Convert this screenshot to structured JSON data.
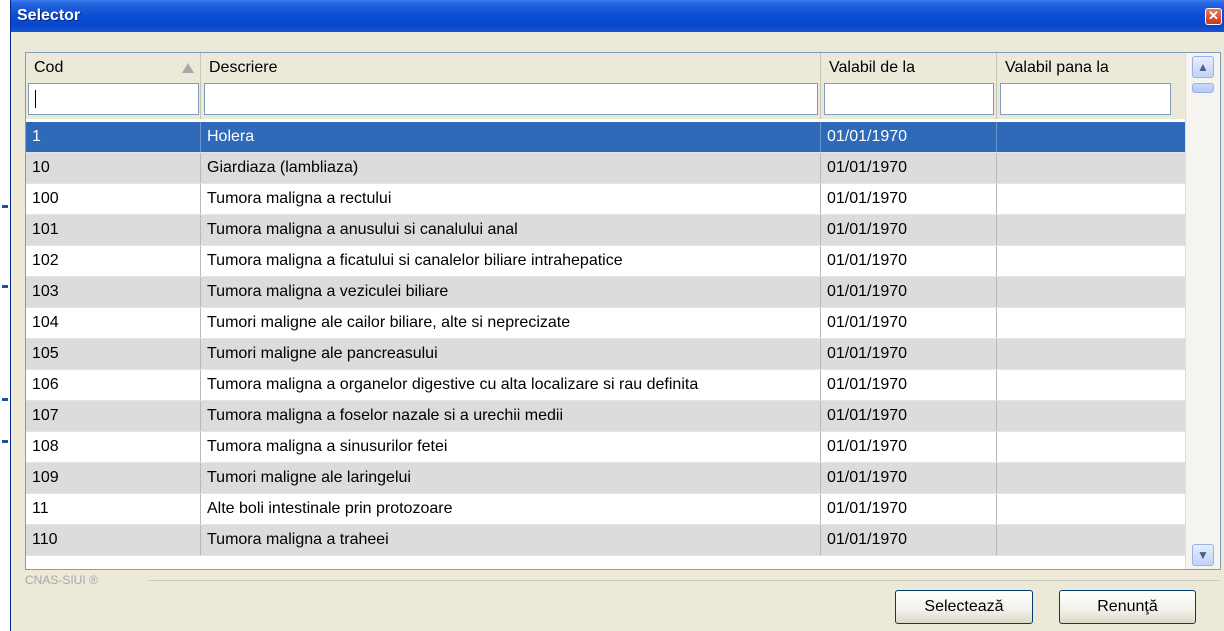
{
  "window": {
    "title": "Selector"
  },
  "grid": {
    "columns": [
      {
        "label": "Cod"
      },
      {
        "label": "Descriere"
      },
      {
        "label": "Valabil de la"
      },
      {
        "label": "Valabil pana la"
      }
    ],
    "filters": {
      "cod": "",
      "descriere": "",
      "valabil_de_la": "",
      "valabil_pana_la": ""
    },
    "rows": [
      {
        "cod": "1",
        "descriere": "Holera",
        "valabil_de_la": "01/01/1970",
        "valabil_pana_la": ""
      },
      {
        "cod": "10",
        "descriere": "Giardiaza (lambliaza)",
        "valabil_de_la": "01/01/1970",
        "valabil_pana_la": ""
      },
      {
        "cod": "100",
        "descriere": "Tumora maligna a rectului",
        "valabil_de_la": "01/01/1970",
        "valabil_pana_la": ""
      },
      {
        "cod": "101",
        "descriere": "Tumora maligna a anusului si canalului anal",
        "valabil_de_la": "01/01/1970",
        "valabil_pana_la": ""
      },
      {
        "cod": "102",
        "descriere": "Tumora maligna a ficatului si canalelor biliare intrahepatice",
        "valabil_de_la": "01/01/1970",
        "valabil_pana_la": ""
      },
      {
        "cod": "103",
        "descriere": "Tumora maligna a veziculei biliare",
        "valabil_de_la": "01/01/1970",
        "valabil_pana_la": ""
      },
      {
        "cod": "104",
        "descriere": "Tumori maligne ale cailor biliare, alte si neprecizate",
        "valabil_de_la": "01/01/1970",
        "valabil_pana_la": ""
      },
      {
        "cod": "105",
        "descriere": "Tumori maligne ale pancreasului",
        "valabil_de_la": "01/01/1970",
        "valabil_pana_la": ""
      },
      {
        "cod": "106",
        "descriere": "Tumora maligna a organelor digestive cu alta localizare si rau definita",
        "valabil_de_la": "01/01/1970",
        "valabil_pana_la": ""
      },
      {
        "cod": "107",
        "descriere": "Tumora maligna a foselor nazale si a urechii medii",
        "valabil_de_la": "01/01/1970",
        "valabil_pana_la": ""
      },
      {
        "cod": "108",
        "descriere": "Tumora maligna a sinusurilor fetei",
        "valabil_de_la": "01/01/1970",
        "valabil_pana_la": ""
      },
      {
        "cod": "109",
        "descriere": "Tumori maligne ale laringelui",
        "valabil_de_la": "01/01/1970",
        "valabil_pana_la": ""
      },
      {
        "cod": "11",
        "descriere": "Alte boli intestinale prin protozoare",
        "valabil_de_la": "01/01/1970",
        "valabil_pana_la": ""
      },
      {
        "cod": "110",
        "descriere": "Tumora maligna a traheei",
        "valabil_de_la": "01/01/1970",
        "valabil_pana_la": ""
      }
    ],
    "selected_index": 0
  },
  "footer": {
    "brand": "CNAS-SIUI ®",
    "select_label": "Selectează",
    "cancel_label": "Renunţă"
  },
  "icons": {
    "close": "close-icon",
    "sort": "sort-asc-icon",
    "scroll_up": "chevron-up-icon",
    "scroll_down": "chevron-down-icon"
  },
  "colors": {
    "titlebar": "#0a4fd6",
    "selected_row": "#2f6ab8",
    "alt_row": "#dcdcdc"
  }
}
